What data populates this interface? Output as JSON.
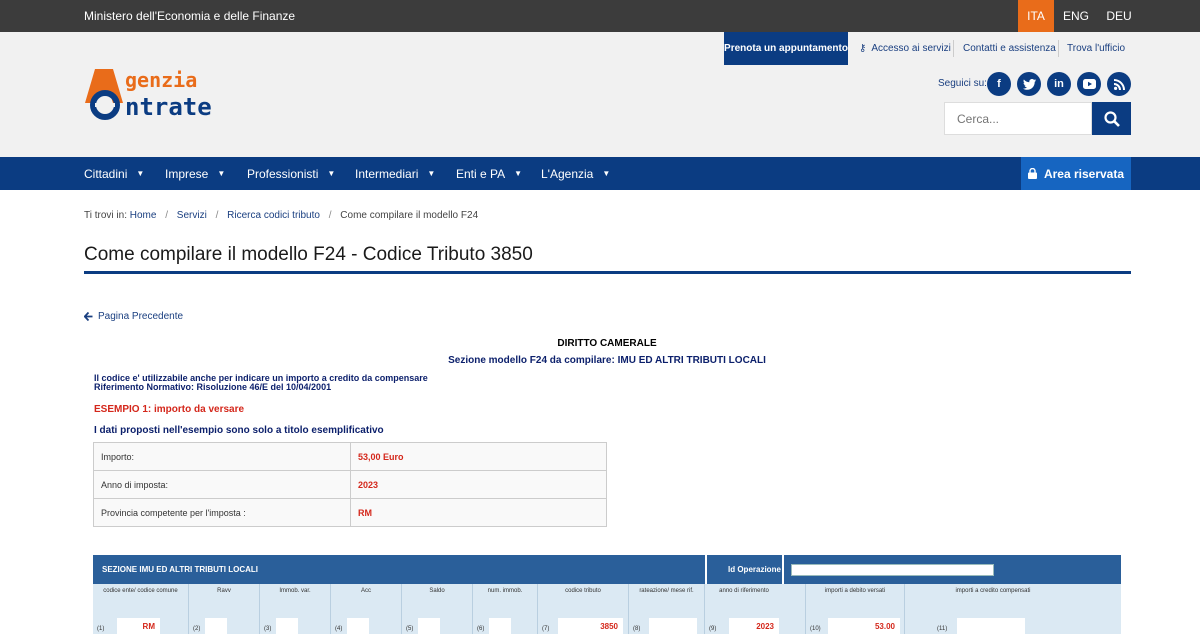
{
  "topbar": {
    "ministry": "Ministero dell'Economia e delle Finanze",
    "languages": [
      "ITA",
      "ENG",
      "DEU"
    ],
    "active_language": "ITA"
  },
  "utility_nav": {
    "primary": "Prenota un appuntamento",
    "links": [
      "Accesso ai servizi",
      "Contatti e assistenza",
      "Trova l'ufficio"
    ]
  },
  "logo": {
    "line1": "genzia",
    "line2": "ntrate"
  },
  "social": {
    "label": "Seguici su:",
    "icons": [
      "facebook-icon",
      "twitter-icon",
      "linkedin-icon",
      "youtube-icon",
      "rss-icon"
    ]
  },
  "search": {
    "placeholder": "Cerca..."
  },
  "main_nav": {
    "items": [
      "Cittadini",
      "Imprese",
      "Professionisti",
      "Intermediari",
      "Enti e PA",
      "L'Agenzia"
    ],
    "reserved_area": "Area riservata"
  },
  "breadcrumb": {
    "prefix": "Ti trovi in:",
    "items": [
      "Home",
      "Servizi",
      "Ricerca codici tributo",
      "Come compilare il modello F24"
    ]
  },
  "page_title": "Come compilare il modello F24 - Codice Tributo 3850",
  "back_link": "Pagina Precedente",
  "document": {
    "heading": "DIRITTO CAMERALE",
    "subheading": "Sezione modello F24 da compilare: IMU ED ALTRI TRIBUTI LOCALI",
    "note_line1": "Il codice e' utilizzabile anche per indicare un importo a credito da compensare",
    "note_line2": "Riferimento Normativo: Risoluzione  46/E del 10/04/2001",
    "example_title": "ESEMPIO 1: importo da versare",
    "disclaimer": "I dati proposti nell'esempio sono solo a titolo esemplificativo",
    "example_rows": [
      {
        "label": "Importo:",
        "value": "53,00 Euro"
      },
      {
        "label": "Anno di imposta:",
        "value": "2023"
      },
      {
        "label": "Provincia competente per l'imposta :",
        "value": "RM"
      }
    ]
  },
  "f24": {
    "section_title": "SEZIONE IMU ED ALTRI TRIBUTI LOCALI",
    "operation_label": "Id Operazione",
    "columns": [
      {
        "label": "codice ente/ codice comune",
        "num": "(1)",
        "value": "RM"
      },
      {
        "label": "Ravv",
        "num": "(2)",
        "value": ""
      },
      {
        "label": "Immob. var.",
        "num": "(3)",
        "value": ""
      },
      {
        "label": "Acc",
        "num": "(4)",
        "value": ""
      },
      {
        "label": "Saldo",
        "num": "(5)",
        "value": ""
      },
      {
        "label": "num. immob.",
        "num": "(6)",
        "value": ""
      },
      {
        "label": "codice tributo",
        "num": "(7)",
        "value": "3850"
      },
      {
        "label": "rateazione/ mese rif.",
        "num": "(8)",
        "value": ""
      },
      {
        "label": "anno di riferimento",
        "num": "(9)",
        "value": "2023"
      },
      {
        "label": "importi a debito versati",
        "num": "(10)",
        "value": "53.00"
      },
      {
        "label": "importi a credito compensati",
        "num": "(11)",
        "value": ""
      }
    ]
  },
  "colors": {
    "brand_blue": "#0b3c82",
    "accent_orange": "#e96c1a",
    "highlight_red": "#d4271b"
  }
}
